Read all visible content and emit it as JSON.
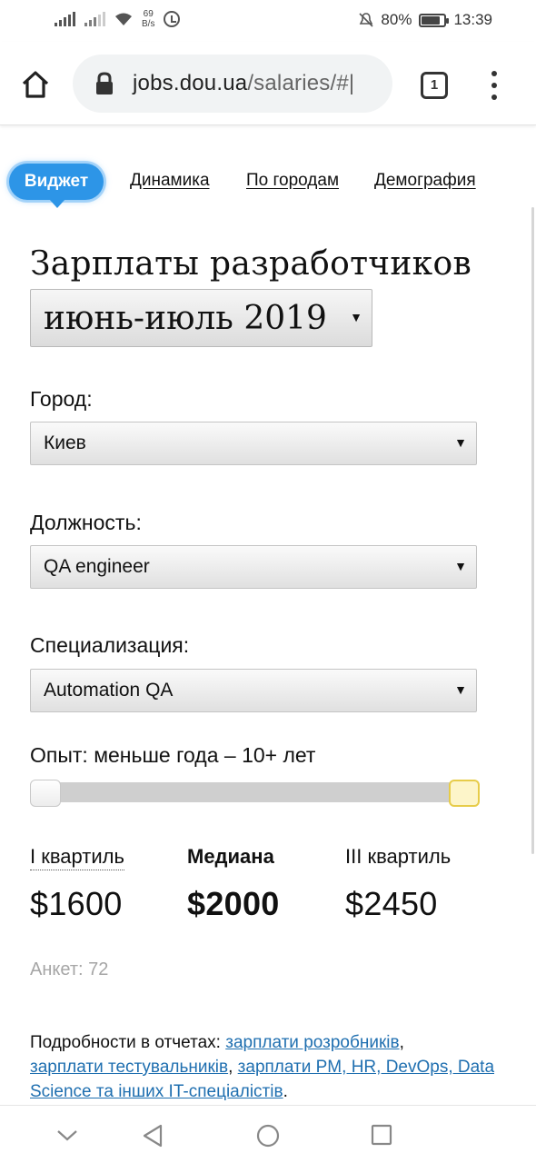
{
  "status_bar": {
    "net_speed_value": "69",
    "net_speed_unit": "B/s",
    "battery": "80%",
    "time": "13:39",
    "battery_level": 0.8
  },
  "browser": {
    "url_host": "jobs.dou.ua",
    "url_path": "/salaries/#|",
    "tab_count": "1"
  },
  "nav": {
    "active": "Виджет",
    "links": [
      "Динамика",
      "По городам",
      "Демография"
    ],
    "accent_color": "#2d95e7"
  },
  "page": {
    "title": "Зарплаты разработчиков",
    "period": "июнь-июль 2019"
  },
  "filters": {
    "city_label": "Город:",
    "city_value": "Киев",
    "position_label": "Должность:",
    "position_value": "QA engineer",
    "spec_label": "Специализация:",
    "spec_value": "Automation QA",
    "experience_label": "Опыт: меньше года – 10+ лет",
    "experience_range": [
      0,
      1
    ]
  },
  "stats": {
    "q1_label": "I квартиль",
    "q1_value": "$1600",
    "median_label": "Медиана",
    "median_value": "$2000",
    "q3_label": "III квартиль",
    "q3_value": "$2450",
    "count": "Анкет: 72"
  },
  "details": {
    "prefix": "Подробности в отчетах: ",
    "link1": "зарплати розробників",
    "sep1": ",",
    "link2": "зарплати тестувальників",
    "sep2": ", ",
    "link3": "зарплати PM, HR, DevOps, Data Science та інших IT-спеціалістів",
    "suffix": "."
  }
}
